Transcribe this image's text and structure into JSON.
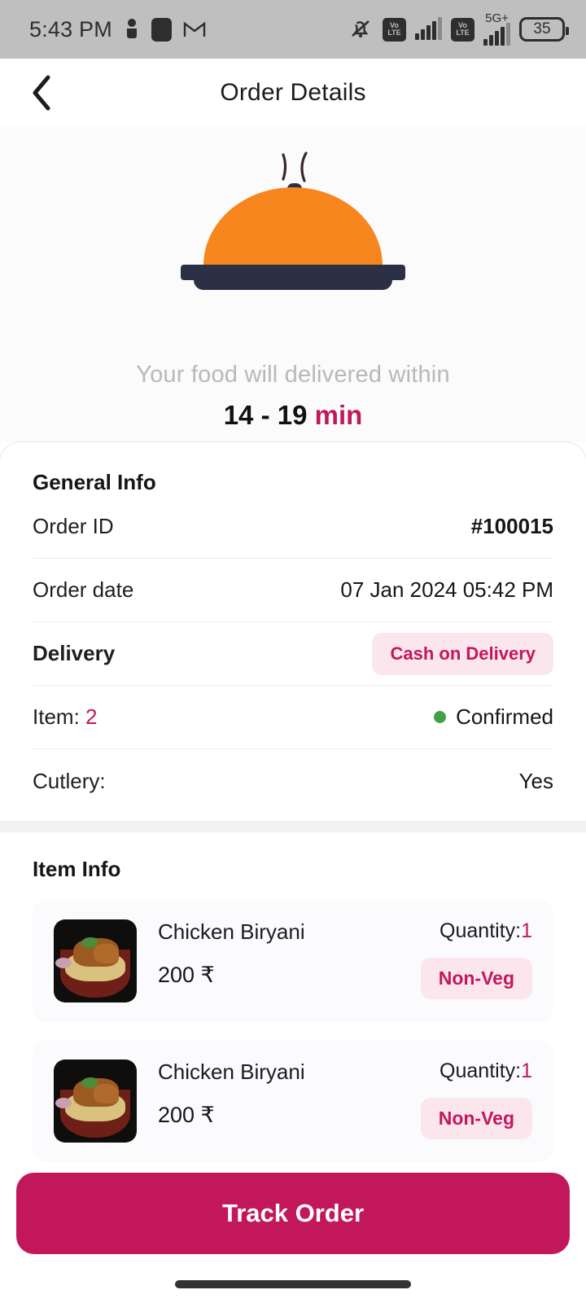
{
  "status_bar": {
    "time": "5:43 PM",
    "left_icons": [
      "person-icon",
      "app-square-icon",
      "gmail-icon"
    ],
    "right_icons": [
      "mute-bell-icon",
      "volte-icon",
      "signal-bars-icon",
      "volte-icon",
      "5g-plus-icon",
      "signal-bars-icon"
    ],
    "network_label": "5G+",
    "volte_line1": "Vo",
    "volte_line2": "LTE",
    "battery_level": "35"
  },
  "appbar": {
    "title": "Order Details",
    "back_icon": "chevron-left-icon"
  },
  "hero": {
    "illustration": "food-cloche-icon",
    "eta_label": "Your food will delivered within",
    "eta_range": "14 - 19",
    "eta_unit": "min",
    "accent_color": "#c2185b"
  },
  "general_info": {
    "title": "General Info",
    "rows": [
      {
        "label": "Order ID",
        "value": "#100015"
      },
      {
        "label": "Order date",
        "value": "07 Jan 2024  05:42 PM"
      },
      {
        "label": "Delivery",
        "value": "Cash on Delivery"
      },
      {
        "label": "Item:",
        "count": "2",
        "status": "Confirmed",
        "status_color": "#43a047"
      },
      {
        "label": "Cutlery:",
        "value": "Yes"
      }
    ]
  },
  "item_info": {
    "title": "Item Info",
    "items": [
      {
        "name": "Chicken Biryani",
        "price": "200 ₹",
        "quantity_label": "Quantity:",
        "quantity": "1",
        "diet_tag": "Non-Veg",
        "thumbnail": "chicken-biryani-photo"
      },
      {
        "name": "Chicken Biryani",
        "price": "200 ₹",
        "quantity_label": "Quantity:",
        "quantity": "1",
        "diet_tag": "Non-Veg",
        "thumbnail": "chicken-biryani-photo"
      }
    ]
  },
  "cta": {
    "label": "Track Order"
  }
}
